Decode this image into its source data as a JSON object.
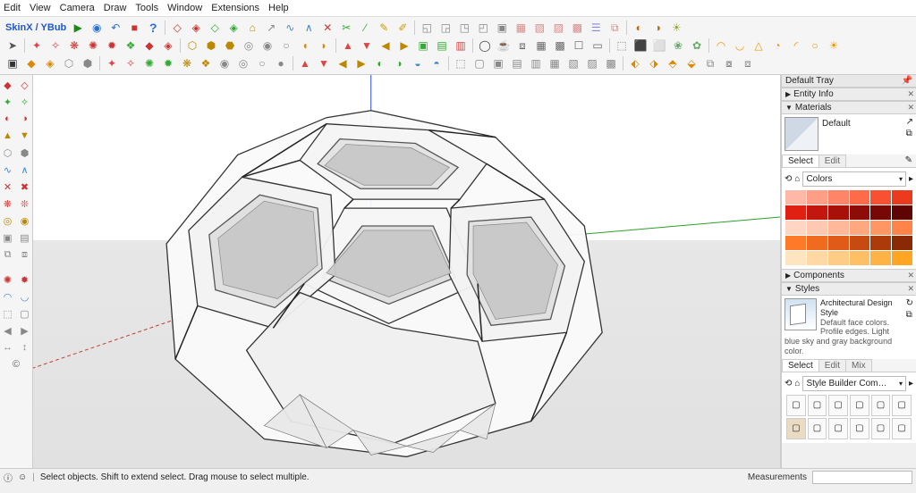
{
  "menu": [
    "Edit",
    "View",
    "Camera",
    "Draw",
    "Tools",
    "Window",
    "Extensions",
    "Help"
  ],
  "plugin_label": "SkinX / YBub",
  "tray": {
    "title": "Default Tray",
    "entity_info": "Entity Info",
    "materials": {
      "title": "Materials",
      "current_name": "Default",
      "tab_select": "Select",
      "tab_edit": "Edit",
      "category": "Colors",
      "swatches": [
        "#ffb8a8",
        "#ff9e87",
        "#ff8468",
        "#ff6a48",
        "#f85030",
        "#eb3a1e",
        "#e02013",
        "#c1170e",
        "#a8110a",
        "#8e0c07",
        "#780805",
        "#5e0503",
        "#ffd6c4",
        "#ffc8b0",
        "#ffb99a",
        "#ffa87f",
        "#ff9664",
        "#ff844a",
        "#ff7a28",
        "#f06a20",
        "#e05a18",
        "#c74a10",
        "#ad3a0a",
        "#8a2a05",
        "#ffe4c0",
        "#ffd8a4",
        "#ffcc86",
        "#ffbf66",
        "#ffb246",
        "#ffa524"
      ]
    },
    "components": "Components",
    "styles": {
      "title": "Styles",
      "current_name": "Architectural Design Style",
      "desc": "Default face colors. Profile edges. Light blue sky and gray background color.",
      "tab_select": "Select",
      "tab_edit": "Edit",
      "tab_mix": "Mix",
      "collection": "Style Builder Competition Wi"
    }
  },
  "status": {
    "hint": "Select objects. Shift to extend select. Drag mouse to select multiple.",
    "measurements_label": "Measurements"
  }
}
